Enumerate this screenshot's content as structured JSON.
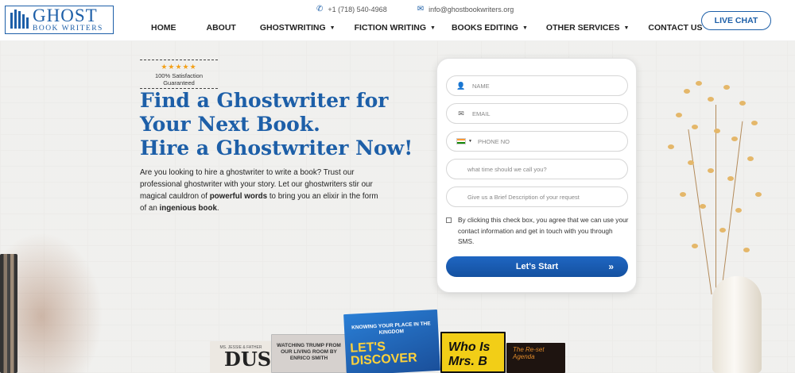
{
  "header": {
    "logo": {
      "top": "GHOST",
      "bottom": "BOOK WRITERS"
    },
    "phone": "+1 (718) 540-4968",
    "email": "info@ghostbookwriters.org",
    "nav": [
      {
        "label": "HOME",
        "has_caret": false
      },
      {
        "label": "ABOUT",
        "has_caret": false
      },
      {
        "label": "GHOSTWRITING",
        "has_caret": true
      },
      {
        "label": "FICTION WRITING",
        "has_caret": true
      },
      {
        "label": "BOOKS EDITING",
        "has_caret": true
      },
      {
        "label": "OTHER SERVICES",
        "has_caret": true
      },
      {
        "label": "CONTACT US",
        "has_caret": false
      },
      {
        "label": "BLOG",
        "has_caret": false
      }
    ],
    "live_chat": "LIVE CHAT"
  },
  "hero": {
    "stars": "★★★★★",
    "satisfaction": "100% Satisfaction Guaranteed",
    "headline": [
      "Find a Ghostwriter for",
      "Your Next Book.",
      "Hire a Ghostwriter Now!"
    ],
    "desc_part1": "Are you looking to hire a ghostwriter to write a book? Trust our professional ghostwriter with your story. Let our ghostwriters stir our magical cauldron of ",
    "desc_bold1": "powerful words",
    "desc_part2": " to bring you an elixir in the form of an ",
    "desc_bold2": "ingenious book",
    "desc_part3": "."
  },
  "form": {
    "name_placeholder": "NAME",
    "email_placeholder": "EMAIL",
    "phone_placeholder": "PHONE NO",
    "time_placeholder": "what time should we call you?",
    "desc_placeholder": "Give us a Brief Description of your request",
    "consent": "By clicking this check box, you agree that we can use your contact information and get in touch with you through SMS.",
    "submit": "Let's Start"
  },
  "books": [
    {
      "small": "MS. JESSIE & FATHER",
      "title": "DUST"
    },
    {
      "title": "WATCHING TRUMP FROM OUR LIVING ROOM BY ENRICO SMITH"
    },
    {
      "subtitle": "KNOWING YOUR PLACE IN THE KINGDOM",
      "title": "LET'S DISCOVER"
    },
    {
      "title": "Who Is Mrs. B"
    },
    {
      "title": "The Re-set Agenda"
    }
  ],
  "colors": {
    "brand_blue": "#1d5fa8",
    "star_orange": "#f3a11a",
    "button_blue": "#1a5bb0"
  }
}
